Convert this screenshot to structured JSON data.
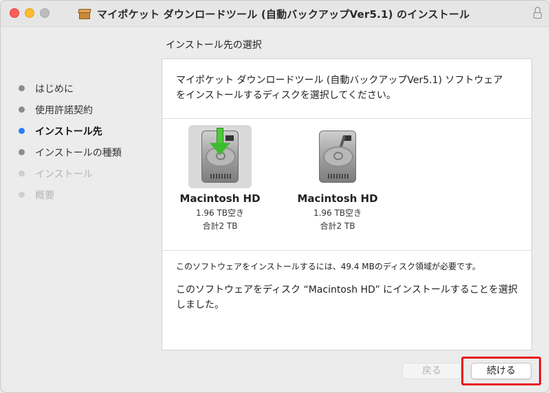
{
  "window": {
    "title": "マイポケット ダウンロードツール (自動バックアップVer5.1) のインストール"
  },
  "section_title": "インストール先の選択",
  "sidebar": {
    "steps": [
      {
        "label": "はじめに",
        "state": "done"
      },
      {
        "label": "使用許諾契約",
        "state": "done"
      },
      {
        "label": "インストール先",
        "state": "active"
      },
      {
        "label": "インストールの種類",
        "state": "done"
      },
      {
        "label": "インストール",
        "state": "disabled"
      },
      {
        "label": "概要",
        "state": "disabled"
      }
    ]
  },
  "main": {
    "intro": "マイポケット ダウンロードツール (自動バックアップVer5.1) ソフトウェアをインストールするディスクを選択してください。",
    "disks": [
      {
        "name": "Macintosh HD",
        "free": "1.96 TB空き",
        "total": "合計2 TB",
        "selected": true
      },
      {
        "name": "Macintosh HD",
        "free": "1.96 TB空き",
        "total": "合計2 TB",
        "selected": false
      }
    ],
    "requirement": "このソフトウェアをインストールするには、49.4 MBのディスク領域が必要です。",
    "selected_message": "このソフトウェアをディスク “Macintosh HD” にインストールすることを選択しました。"
  },
  "buttons": {
    "back": "戻る",
    "continue": "続ける"
  },
  "colors": {
    "active_step": "#2d7cf6",
    "highlight": "#e8131b",
    "close": "#fe5f57",
    "minimize": "#febc2e"
  }
}
